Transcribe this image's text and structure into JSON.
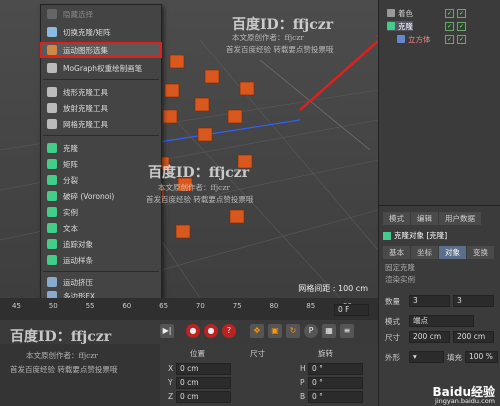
{
  "menu": {
    "items": [
      {
        "label": "隐藏选择",
        "color": "#666"
      },
      {
        "label": "切换克隆/矩阵",
        "color": "#8bd"
      },
      {
        "label": "运动图形选集",
        "color": "#c84",
        "highlight": true
      },
      {
        "label": "MoGraph权重绘制画笔",
        "color": "#bbb"
      },
      {
        "label": "线形克隆工具",
        "color": "#bbb"
      },
      {
        "label": "放射克隆工具",
        "color": "#bbb"
      },
      {
        "label": "网格克隆工具",
        "color": "#bbb"
      },
      {
        "label": "克隆",
        "color": "#4c8"
      },
      {
        "label": "矩阵",
        "color": "#4c8"
      },
      {
        "label": "分裂",
        "color": "#4c8"
      },
      {
        "label": "破碎 (Voronoi)",
        "color": "#4c8"
      },
      {
        "label": "实例",
        "color": "#4c8"
      },
      {
        "label": "文本",
        "color": "#4c8"
      },
      {
        "label": "追踪对象",
        "color": "#4c8"
      },
      {
        "label": "运动样条",
        "color": "#4c8"
      },
      {
        "label": "运动挤压",
        "color": "#8ac"
      },
      {
        "label": "多边形FX",
        "color": "#8ac"
      }
    ]
  },
  "viewport": {
    "grid_label": "网格间距 : 100 cm"
  },
  "objects": {
    "items": [
      {
        "name": "着色"
      },
      {
        "name": "克隆"
      },
      {
        "name": "立方体"
      }
    ]
  },
  "attributes": {
    "header_tabs": [
      "模式",
      "编辑",
      "用户数据"
    ],
    "title": "克隆对象 [克隆]",
    "tabs": [
      "基本",
      "坐标",
      "对象",
      "变换"
    ],
    "active_tab": "对象",
    "mode_label": "模式",
    "mode_value": "网格",
    "count_label": "数量",
    "count_values": [
      "3",
      "3"
    ],
    "size_label": "尺寸",
    "size_values": [
      "200 cm",
      "200 cm"
    ],
    "fill_label": "填充",
    "fill_value": "100 %",
    "shape_label": "外形",
    "options": [
      "固定克隆",
      "固定纹理",
      "渲染实例"
    ],
    "mode_dropdown": "端点"
  },
  "timeline": {
    "ticks": [
      "45",
      "50",
      "55",
      "60",
      "65",
      "70",
      "75",
      "80",
      "85",
      "90"
    ],
    "frame_value": "0 F"
  },
  "coords": {
    "headers": [
      "位置",
      "尺寸",
      "旋转"
    ],
    "rows": [
      {
        "axis": "X",
        "pos": "0 cm",
        "size_axis": "H",
        "rot": "0 °"
      },
      {
        "axis": "Y",
        "pos": "0 cm",
        "size_axis": "P",
        "rot": "0 °"
      },
      {
        "axis": "Z",
        "pos": "0 cm",
        "size_axis": "B",
        "rot": "0 °"
      }
    ]
  },
  "watermarks": {
    "title": "百度ID：ffjczr",
    "line1": "本文原创作者：ffjczr",
    "line2": "首发百度经验 转载要点赞投票哦"
  },
  "brand": {
    "logo": "Baidu经验",
    "url": "jingyan.baidu.com"
  }
}
